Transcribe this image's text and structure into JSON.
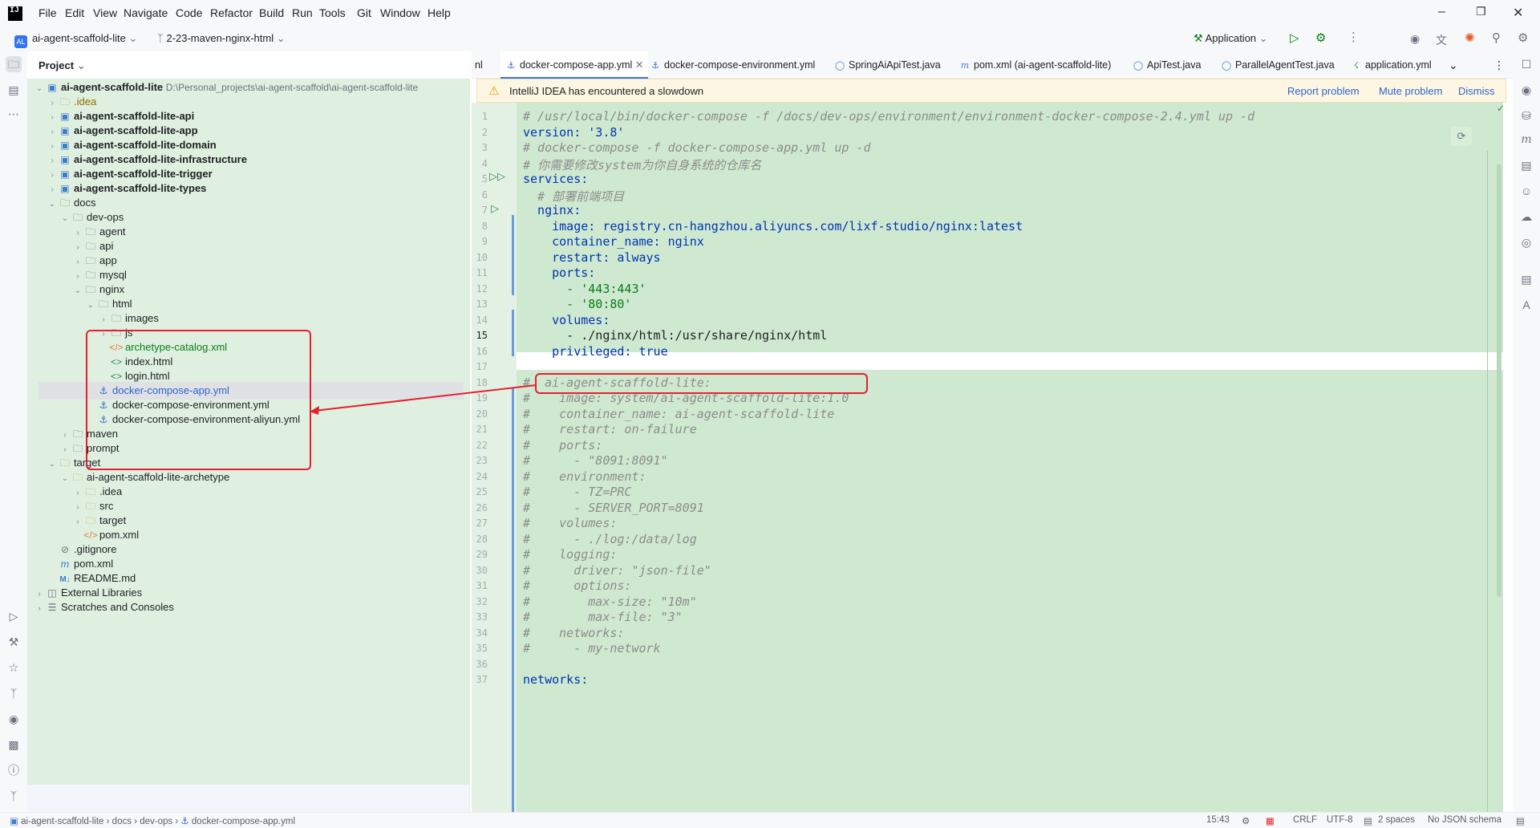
{
  "menu": [
    "File",
    "Edit",
    "View",
    "Navigate",
    "Code",
    "Refactor",
    "Build",
    "Run",
    "Tools",
    "Git",
    "Window",
    "Help"
  ],
  "toolbar": {
    "project_badge": "AL",
    "project": "ai-agent-scaffold-lite",
    "branch": "2-23-maven-nginx-html",
    "run_config": "Application"
  },
  "project_panel": {
    "title": "Project"
  },
  "tree": [
    {
      "label": "ai-agent-scaffold-lite",
      "path": "D:\\Personal_projects\\ai-agent-scaffold\\ai-agent-scaffold-lite"
    },
    {
      "label": ".idea"
    },
    {
      "label": "ai-agent-scaffold-lite-api"
    },
    {
      "label": "ai-agent-scaffold-lite-app"
    },
    {
      "label": "ai-agent-scaffold-lite-domain"
    },
    {
      "label": "ai-agent-scaffold-lite-infrastructure"
    },
    {
      "label": "ai-agent-scaffold-lite-trigger"
    },
    {
      "label": "ai-agent-scaffold-lite-types"
    },
    {
      "label": "docs"
    },
    {
      "label": "dev-ops"
    },
    {
      "label": "agent"
    },
    {
      "label": "api"
    },
    {
      "label": "app"
    },
    {
      "label": "mysql"
    },
    {
      "label": "nginx"
    },
    {
      "label": "html"
    },
    {
      "label": "images"
    },
    {
      "label": "js"
    },
    {
      "label": "archetype-catalog.xml"
    },
    {
      "label": "index.html"
    },
    {
      "label": "login.html"
    },
    {
      "label": "docker-compose-app.yml"
    },
    {
      "label": "docker-compose-environment.yml"
    },
    {
      "label": "docker-compose-environment-aliyun.yml"
    },
    {
      "label": "maven"
    },
    {
      "label": "prompt"
    },
    {
      "label": "target"
    },
    {
      "label": "ai-agent-scaffold-lite-archetype"
    },
    {
      "label": ".idea"
    },
    {
      "label": "src"
    },
    {
      "label": "target"
    },
    {
      "label": "pom.xml"
    },
    {
      "label": ".gitignore"
    },
    {
      "label": "pom.xml"
    },
    {
      "label": "README.md"
    },
    {
      "label": "External Libraries"
    },
    {
      "label": "Scratches and Consoles"
    }
  ],
  "tabs": [
    "nl",
    "docker-compose-app.yml",
    "docker-compose-environment.yml",
    "SpringAiApiTest.java",
    "pom.xml (ai-agent-scaffold-lite)",
    "ApiTest.java",
    "ParallelAgentTest.java",
    "application.yml"
  ],
  "banner": {
    "text": "IntelliJ IDEA has encountered a slowdown",
    "report": "Report problem",
    "mute": "Mute problem",
    "dismiss": "Dismiss"
  },
  "code_lines": [
    "# /usr/local/bin/docker-compose -f /docs/dev-ops/environment/environment-docker-compose-2.4.yml up -d",
    "version: '3.8'",
    "# docker-compose -f docker-compose-app.yml up -d",
    "# 你需要修改system为你自身系统的仓库名",
    "services:",
    "  # 部署前端项目",
    "  nginx:",
    "    image: registry.cn-hangzhou.aliyuncs.com/lixf-studio/nginx:latest",
    "    container_name: nginx",
    "    restart: always",
    "    ports:",
    "      - '443:443'",
    "      - '80:80'",
    "    volumes:",
    "      - ./nginx/html:/usr/share/nginx/html",
    "    privileged: true",
    "",
    "#  ai-agent-scaffold-lite:",
    "#    image: system/ai-agent-scaffold-lite:1.0",
    "#    container_name: ai-agent-scaffold-lite",
    "#    restart: on-failure",
    "#    ports:",
    "#      - \"8091:8091\"",
    "#    environment:",
    "#      - TZ=PRC",
    "#      - SERVER_PORT=8091",
    "#    volumes:",
    "#      - ./log:/data/log",
    "#    logging:",
    "#      driver: \"json-file\"",
    "#      options:",
    "#        max-size: \"10m\"",
    "#        max-file: \"3\"",
    "#    networks:",
    "#      - my-network",
    "",
    "networks:"
  ],
  "line_numbers": [
    "1",
    "2",
    "3",
    "4",
    "5",
    "6",
    "7",
    "8",
    "9",
    "10",
    "11",
    "12",
    "13",
    "14",
    "15",
    "16",
    "17",
    "18",
    "19",
    "20",
    "21",
    "22",
    "23",
    "24",
    "25",
    "26",
    "27",
    "28",
    "29",
    "30",
    "31",
    "32",
    "33",
    "34",
    "35",
    "36",
    "37"
  ],
  "statusbar": {
    "crumbs": [
      "ai-agent-scaffold-lite",
      "docs",
      "dev-ops",
      "docker-compose-app.yml"
    ],
    "position": "15:43",
    "line_sep": "CRLF",
    "encoding": "UTF-8",
    "indent": "2 spaces",
    "schema": "No JSON schema"
  }
}
